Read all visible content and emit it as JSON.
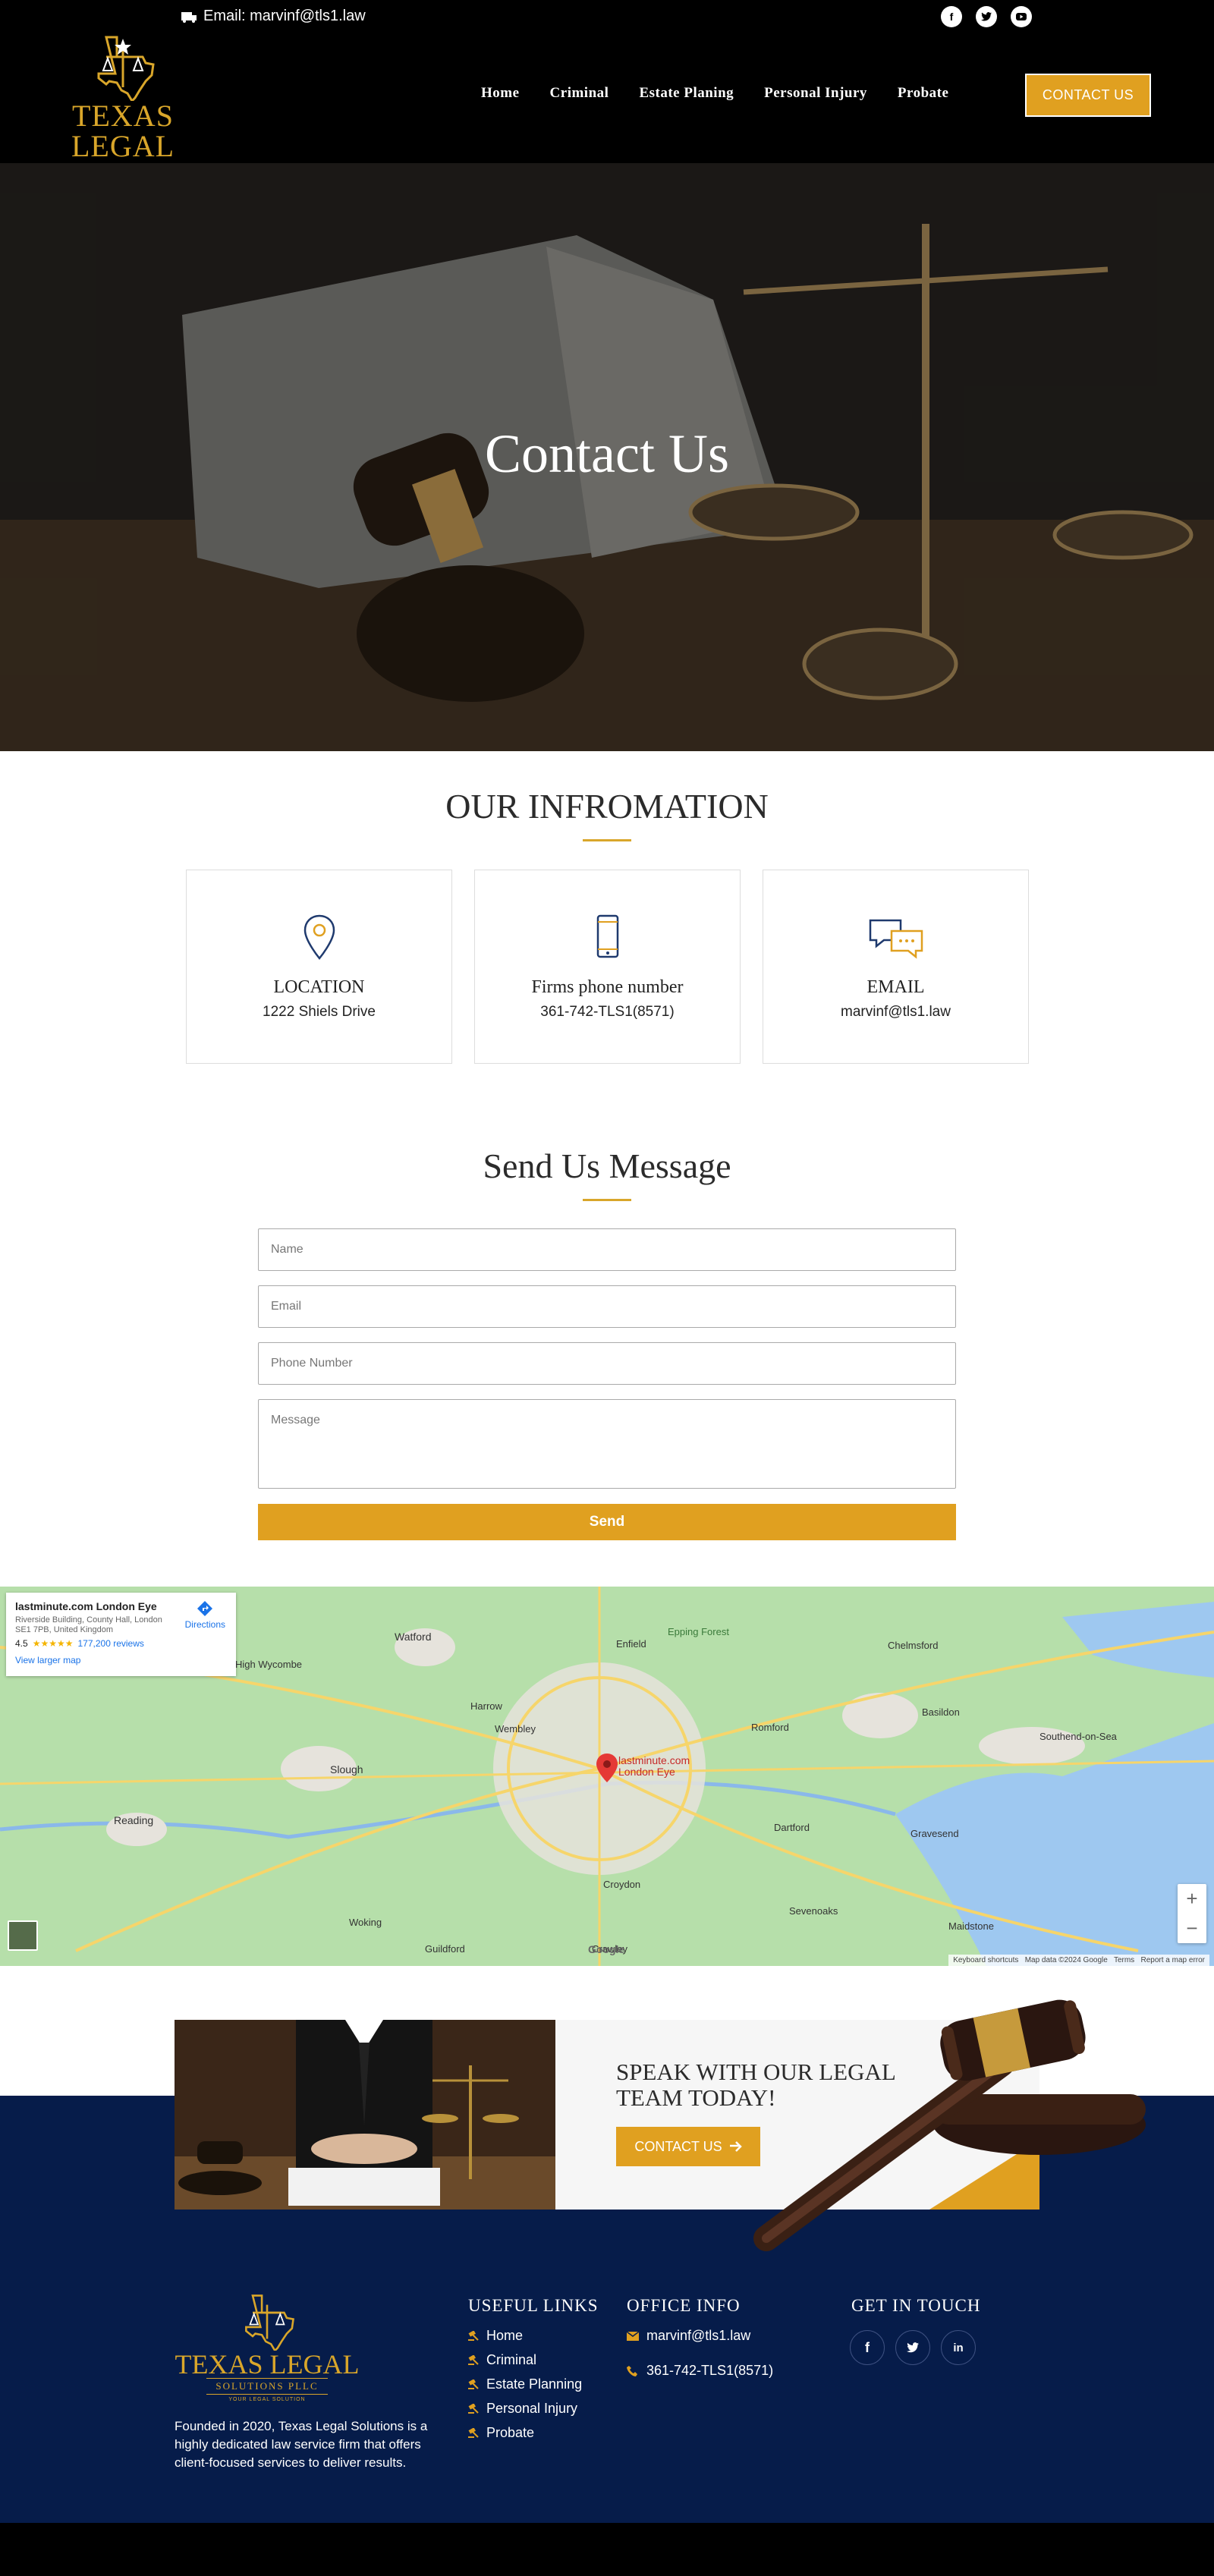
{
  "header": {
    "email_label": "Email: marvinf@tls1.law",
    "logo": {
      "main": "TEXAS LEGAL",
      "sub": "SOLUTIONS PLLC",
      "tagline": "YOUR LEGAL SOLUTION"
    },
    "social": [
      "facebook-icon",
      "twitter-icon",
      "youtube-icon"
    ],
    "nav": [
      "Home",
      "Criminal",
      "Estate Planing",
      "Personal Injury",
      "Probate"
    ],
    "cta": "CONTACT US"
  },
  "hero": {
    "title": "Contact Us"
  },
  "info": {
    "title": "OUR INFROMATION",
    "cards": [
      {
        "icon": "location-pin-icon",
        "title": "LOCATION",
        "value": "1222 Shiels Drive"
      },
      {
        "icon": "mobile-phone-icon",
        "title": "Firms phone number",
        "value": "361-742-TLS1(8571)"
      },
      {
        "icon": "chat-bubbles-icon",
        "title": "EMAIL",
        "value": "marvinf@tls1.law"
      }
    ]
  },
  "form": {
    "title": "Send Us Message",
    "placeholders": {
      "name": "Name",
      "email": "Email",
      "phone": "Phone Number",
      "message": "Message"
    },
    "send": "Send"
  },
  "map": {
    "place": "lastminute.com London Eye",
    "address": "Riverside Building, County Hall, London SE1 7PB, United Kingdom",
    "rating": "4.5",
    "stars": "★★★★★",
    "reviews": "177,200 reviews",
    "directions": "Directions",
    "larger": "View larger map",
    "marker": "lastminute.com London Eye",
    "zoom_in": "+",
    "zoom_out": "−",
    "attribution": "Keyboard shortcuts   Map data ©2024 Google   Terms   Report a map error",
    "google": "Google",
    "places": [
      "Watford",
      "Enfield",
      "Epping Forest",
      "Harrow",
      "Wembley",
      "Romford",
      "Basildon",
      "Southend-on-Sea",
      "Slough",
      "Reading",
      "Croydon",
      "Crawley",
      "Sevenoaks",
      "Maidstone",
      "Gravesend",
      "Dartford",
      "Guildford",
      "Woking",
      "High Wycombe",
      "Chelmsford"
    ]
  },
  "cta_band": {
    "title_line1": "SPEAK WITH OUR LEGAL",
    "title_line2": "TEAM TODAY!",
    "button": "CONTACT US"
  },
  "footer": {
    "about": "Founded in 2020, Texas Legal Solutions is a highly dedicated law service firm that offers client-focused services to deliver results.",
    "useful_title": "USEFUL LINKS",
    "links": [
      "Home",
      "Criminal",
      "Estate Planning",
      "Personal Injury",
      "Probate"
    ],
    "office_title": "OFFICE INFO",
    "office_email": "marvinf@tls1.law",
    "office_phone": "361-742-TLS1(8571)",
    "touch_title": "GET IN TOUCH",
    "social": [
      "facebook-icon",
      "twitter-icon",
      "linkedin-icon"
    ]
  },
  "colors": {
    "gold": "#e0a020",
    "navy": "#061c4a",
    "black": "#000000"
  }
}
